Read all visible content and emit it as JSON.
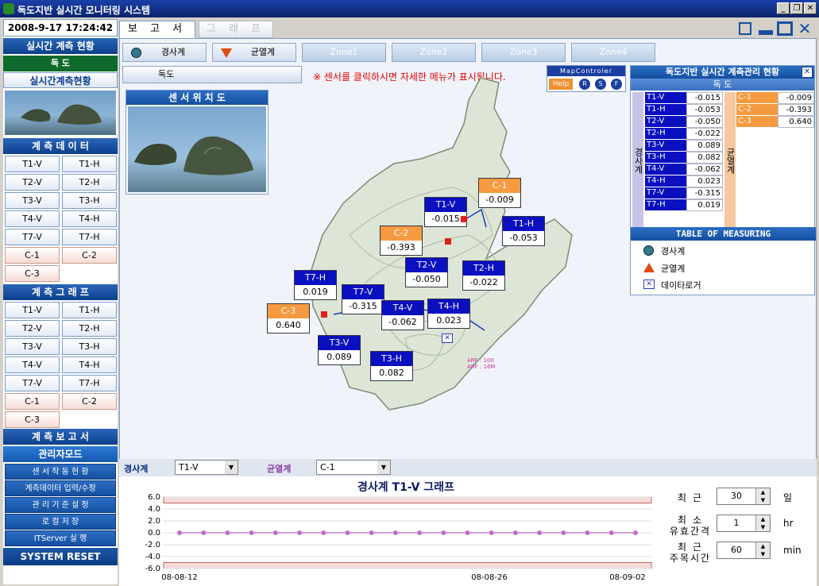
{
  "window": {
    "title": "독도지반 실시간 모니터링 시스템",
    "min": "_",
    "restore": "❐",
    "close": "✕"
  },
  "sidebar": {
    "datetime": "2008-9-17  17:24:42",
    "live_head": "실시간 계측 현황",
    "site": "독 도",
    "live_status": "실시간계측현황",
    "data_head": "계 측 데 이 터",
    "data_buttons": [
      "T1-V",
      "T1-H",
      "T2-V",
      "T2-H",
      "T3-V",
      "T3-H",
      "T4-V",
      "T4-H",
      "T7-V",
      "T7-H",
      "C-1",
      "C-2",
      "C-3"
    ],
    "graph_head": "계 측 그 래 프",
    "graph_buttons": [
      "T1-V",
      "T1-H",
      "T2-V",
      "T2-H",
      "T3-V",
      "T3-H",
      "T4-V",
      "T4-H",
      "T7-V",
      "T7-H",
      "C-1",
      "C-2",
      "C-3"
    ],
    "report_head": "계 측 보 고 서",
    "admin_head": "관리자모드",
    "admin_items": [
      "센 서 작 동 현 황",
      "계측데이터 입력/수정",
      "관 리 기 준 설 정",
      "로  컬  저  장",
      "ITServer  실  행"
    ],
    "reset": "SYSTEM RESET"
  },
  "tabs": [
    "보 고 서",
    "그 래 프"
  ],
  "toolbar": {
    "inclinometer": "경사계",
    "crackmeter": "균열계",
    "zones": [
      "Zone1",
      "Zone2",
      "Zone3",
      "Zone4"
    ]
  },
  "site_button": "독도",
  "notice": "※ 센서를 클릭하시면 자세한 메뉴가 표시됩니다.",
  "location_title": "센 서 위 치 도",
  "map_controller": {
    "title": "MapControler",
    "help": "Help",
    "buttons": [
      "R",
      "S",
      "F"
    ]
  },
  "map_labels": [
    {
      "name": "C-1",
      "value": "-0.009",
      "type": "crack"
    },
    {
      "name": "T1-V",
      "value": "-0.015",
      "type": "tilt"
    },
    {
      "name": "T1-H",
      "value": "-0.053",
      "type": "tilt"
    },
    {
      "name": "C-2",
      "value": "-0.393",
      "type": "crack"
    },
    {
      "name": "T2-V",
      "value": "-0.050",
      "type": "tilt"
    },
    {
      "name": "T2-H",
      "value": "-0.022",
      "type": "tilt"
    },
    {
      "name": "T7-H",
      "value": "0.019",
      "type": "tilt"
    },
    {
      "name": "T7-V",
      "value": "-0.315",
      "type": "tilt"
    },
    {
      "name": "C-3",
      "value": "0.640",
      "type": "crack"
    },
    {
      "name": "T4-V",
      "value": "-0.062",
      "type": "tilt"
    },
    {
      "name": "T4-H",
      "value": "0.023",
      "type": "tilt"
    },
    {
      "name": "T3-V",
      "value": "0.089",
      "type": "tilt"
    },
    {
      "name": "T3-H",
      "value": "0.082",
      "type": "tilt"
    }
  ],
  "arf": "ARF : 100\nARF : 16M",
  "status_table": {
    "title": "독도지반 실시간 계측관리 현황",
    "site": "독 도",
    "tilt_group": "경사계",
    "crack_group": "균열계",
    "tilt_rows": [
      [
        "T1-V",
        "-0.015"
      ],
      [
        "T1-H",
        "-0.053"
      ],
      [
        "T2-V",
        "-0.050"
      ],
      [
        "T2-H",
        "-0.022"
      ],
      [
        "T3-V",
        "0.089"
      ],
      [
        "T3-H",
        "0.082"
      ],
      [
        "T4-V",
        "-0.062"
      ],
      [
        "T4-H",
        "0.023"
      ],
      [
        "T7-V",
        "-0.315"
      ],
      [
        "T7-H",
        "0.019"
      ]
    ],
    "crack_rows": [
      [
        "C-1",
        "-0.009"
      ],
      [
        "C-2",
        "-0.393"
      ],
      [
        "C-3",
        "0.640"
      ]
    ]
  },
  "legend": {
    "title": "TABLE OF MEASURING",
    "items": [
      "경사계",
      "균열계",
      "데이타로거"
    ]
  },
  "graph_controls": {
    "tilt_label": "경사계",
    "tilt_select": "T1-V",
    "crack_label": "균열계",
    "crack_select": "C-1"
  },
  "graph": {
    "title": "경사계 T1-V 그래프",
    "y_ticks": [
      "6.0",
      "4.0",
      "2.0",
      "0.0",
      "-2.0",
      "-4.0",
      "-6.0"
    ],
    "x_ticks": [
      "08-08-12",
      "08-08-26",
      "08-09-02"
    ]
  },
  "settings": [
    {
      "label_lines": [
        "최 근"
      ],
      "value": "30",
      "unit": "일"
    },
    {
      "label_lines": [
        "최 소",
        "유효간격"
      ],
      "value": "1",
      "unit": "hr"
    },
    {
      "label_lines": [
        "최 근",
        "주목시간"
      ],
      "value": "60",
      "unit": "min"
    }
  ],
  "chart_data": {
    "type": "line",
    "title": "경사계 T1-V 그래프",
    "xlabel": "",
    "ylabel": "",
    "ylim": [
      -6,
      6
    ],
    "x_ticks": [
      "08-08-12",
      "08-08-26",
      "08-09-02"
    ],
    "series": [
      {
        "values": [
          0,
          0,
          0,
          0,
          0,
          0,
          0,
          0,
          0,
          0,
          0,
          0,
          0,
          0,
          0,
          0,
          0,
          0,
          0,
          0
        ]
      }
    ],
    "thresholds": [
      5,
      -5
    ]
  }
}
